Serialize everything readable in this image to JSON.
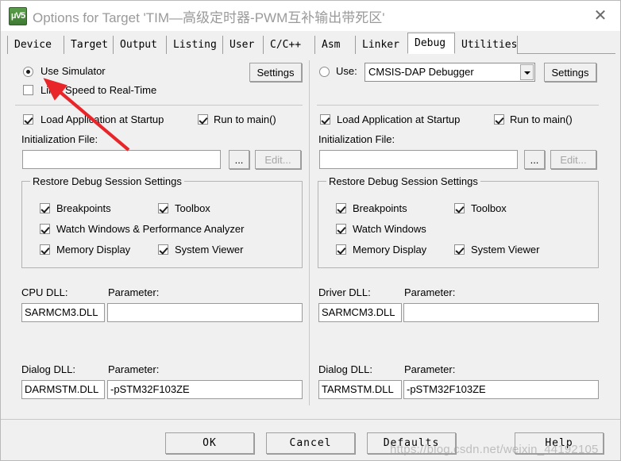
{
  "window": {
    "title": "Options for Target 'TIM—高级定时器-PWM互补输出带死区'",
    "icon": "keil-uvision5-icon",
    "close_label": "✕"
  },
  "tabs": [
    {
      "label": "Device",
      "selected": false
    },
    {
      "label": "Target",
      "selected": false
    },
    {
      "label": "Output",
      "selected": false
    },
    {
      "label": "Listing",
      "selected": false
    },
    {
      "label": "User",
      "selected": false
    },
    {
      "label": "C/C++",
      "selected": false
    },
    {
      "label": "Asm",
      "selected": false
    },
    {
      "label": "Linker",
      "selected": false
    },
    {
      "label": "Debug",
      "selected": true
    },
    {
      "label": "Utilities",
      "selected": false
    }
  ],
  "left": {
    "use_simulator_label": "Use Simulator",
    "use_simulator_checked": true,
    "limit_speed_label": "Limit Speed to Real-Time",
    "limit_speed_checked": false,
    "settings_label": "Settings",
    "load_app_label": "Load Application at Startup",
    "load_app_checked": true,
    "run_to_main_label": "Run to main()",
    "run_to_main_checked": true,
    "init_file_label": "Initialization File:",
    "init_file_value": "",
    "browse_label": "...",
    "edit_label": "Edit...",
    "group_title": "Restore Debug Session Settings",
    "restore": [
      {
        "label": "Breakpoints",
        "checked": true
      },
      {
        "label": "Toolbox",
        "checked": true
      },
      {
        "label": "Watch Windows & Performance Analyzer",
        "checked": true
      },
      {
        "label": "Memory Display",
        "checked": true
      },
      {
        "label": "System Viewer",
        "checked": true
      }
    ],
    "cpu_dll_label": "CPU DLL:",
    "cpu_dll_value": "SARMCM3.DLL",
    "cpu_param_label": "Parameter:",
    "cpu_param_value": "",
    "dialog_dll_label": "Dialog DLL:",
    "dialog_dll_value": "DARMSTM.DLL",
    "dialog_param_label": "Parameter:",
    "dialog_param_value": "-pSTM32F103ZE"
  },
  "right": {
    "use_label": "Use:",
    "use_checked": false,
    "debugger_value": "CMSIS-DAP Debugger",
    "settings_label": "Settings",
    "load_app_label": "Load Application at Startup",
    "load_app_checked": true,
    "run_to_main_label": "Run to main()",
    "run_to_main_checked": true,
    "init_file_label": "Initialization File:",
    "init_file_value": "",
    "browse_label": "...",
    "edit_label": "Edit...",
    "group_title": "Restore Debug Session Settings",
    "restore": [
      {
        "label": "Breakpoints",
        "checked": true
      },
      {
        "label": "Toolbox",
        "checked": true
      },
      {
        "label": "Watch Windows",
        "checked": true
      },
      {
        "label": "Memory Display",
        "checked": true
      },
      {
        "label": "System Viewer",
        "checked": true
      }
    ],
    "driver_dll_label": "Driver DLL:",
    "driver_dll_value": "SARMCM3.DLL",
    "driver_param_label": "Parameter:",
    "driver_param_value": "",
    "dialog_dll_label": "Dialog DLL:",
    "dialog_dll_value": "TARMSTM.DLL",
    "dialog_param_label": "Parameter:",
    "dialog_param_value": "-pSTM32F103ZE"
  },
  "footer": {
    "ok_label": "OK",
    "cancel_label": "Cancel",
    "defaults_label": "Defaults",
    "help_label": "Help"
  },
  "annotation": {
    "arrow_color": "#e8262a",
    "watermark": "https://blog.csdn.net/weixin_44192105"
  }
}
